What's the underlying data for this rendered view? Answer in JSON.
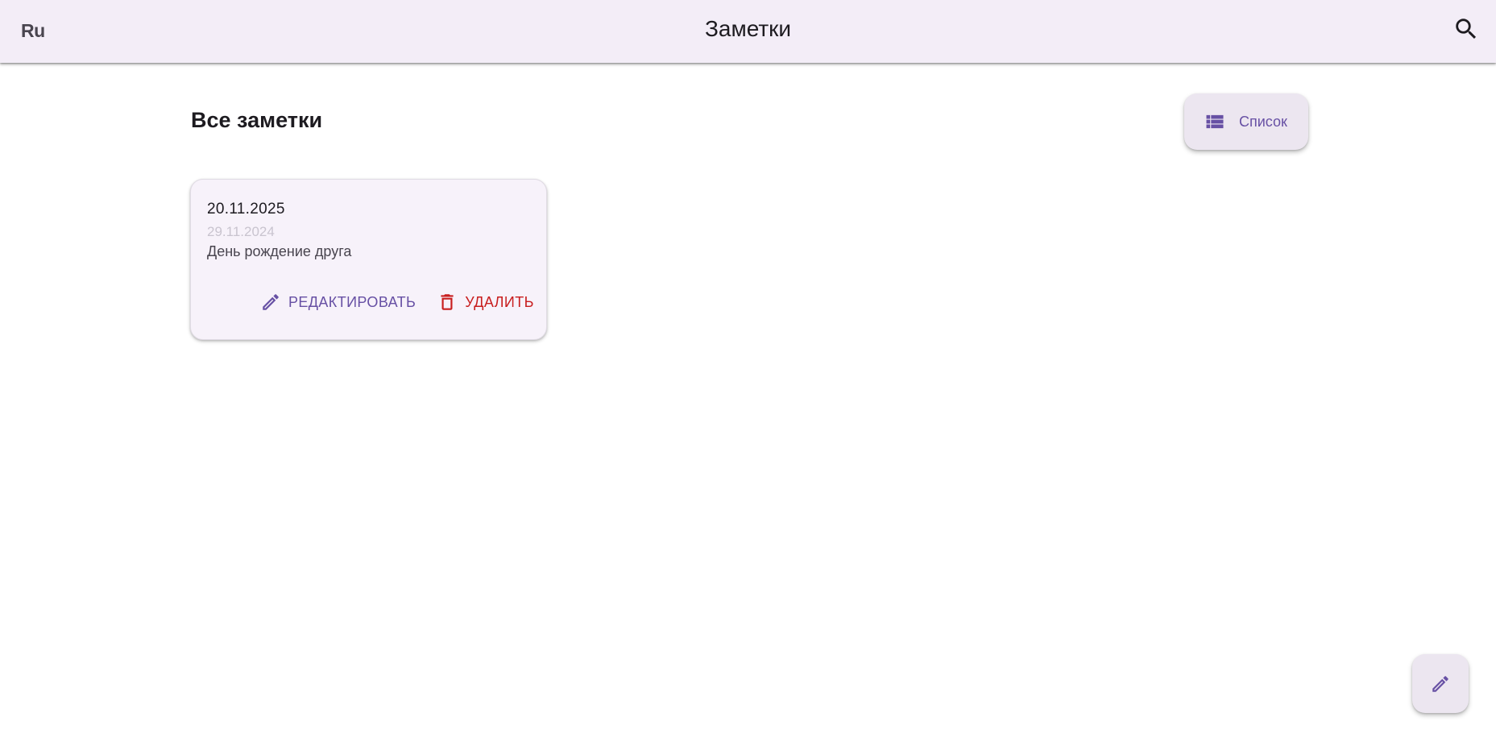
{
  "appbar": {
    "lang_label": "Ru",
    "title": "Заметки",
    "search_icon": "search-icon"
  },
  "main": {
    "section_title": "Все заметки",
    "view_toggle": {
      "label": "Список",
      "icon": "list-icon"
    }
  },
  "notes": [
    {
      "date": "20.11.2025",
      "created": "29.11.2024",
      "text": "День рождение друга",
      "edit_label": "РЕДАКТИРОВАТЬ",
      "delete_label": "УДАЛИТЬ"
    }
  ],
  "fab": {
    "icon": "pencil-icon"
  },
  "colors": {
    "appbar_bg": "#f3edf7",
    "primary": "#6750a4",
    "danger": "#c81e1e",
    "card_bg": "#f7f2fa",
    "muted_text": "#c9c4cf"
  }
}
